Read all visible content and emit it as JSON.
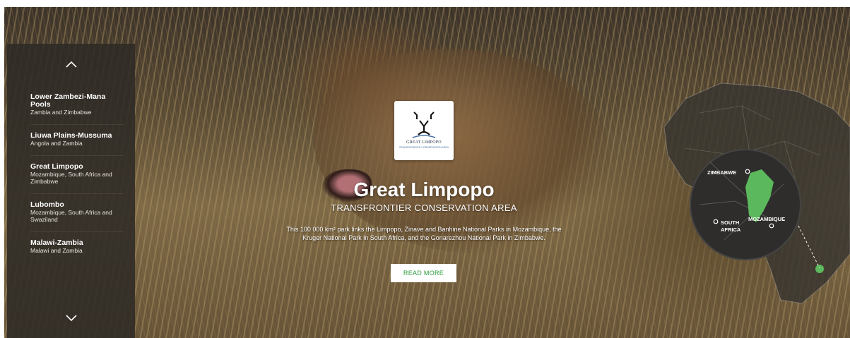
{
  "sidebar": {
    "up_icon": "chevron-up-icon",
    "down_icon": "chevron-down-icon",
    "items": [
      {
        "name": "Lower Zambezi-Mana Pools",
        "location": "Zambia and Zimbabwe"
      },
      {
        "name": "Liuwa Plains-Mussuma",
        "location": "Angola and Zambia"
      },
      {
        "name": "Great Limpopo",
        "location": "Mozambique, South Africa and Zimbabwe"
      },
      {
        "name": "Lubombo",
        "location": "Mozambique, South Africa and Swaziland"
      },
      {
        "name": "Malawi-Zambia",
        "location": "Malawi and Zambia"
      }
    ]
  },
  "hero": {
    "logo_text": "GREAT LIMPOPO",
    "logo_subtext": "TRANSFRONTIER CONSERVATION AREA",
    "title": "Great Limpopo",
    "subtitle": "TRANSFRONTIER CONSERVATION AREA",
    "description": "This 100 000 km² park links the Limpopo, Zinave and Banhine National Parks in Mozambique, the Kruger National Park in South Africa, and the Gonarezhou National Park in Zimbabwe.",
    "read_more": "READ MORE"
  },
  "map": {
    "labels": {
      "zimbabwe": "ZIMBABWE",
      "south_africa_1": "SOUTH",
      "south_africa_2": "AFRICA",
      "mozambique": "MOZAMBIQUE"
    },
    "accent_color": "#5cb85c"
  },
  "colors": {
    "accent": "#2c9a3a",
    "sidebar_bg": "#2d2a26"
  }
}
